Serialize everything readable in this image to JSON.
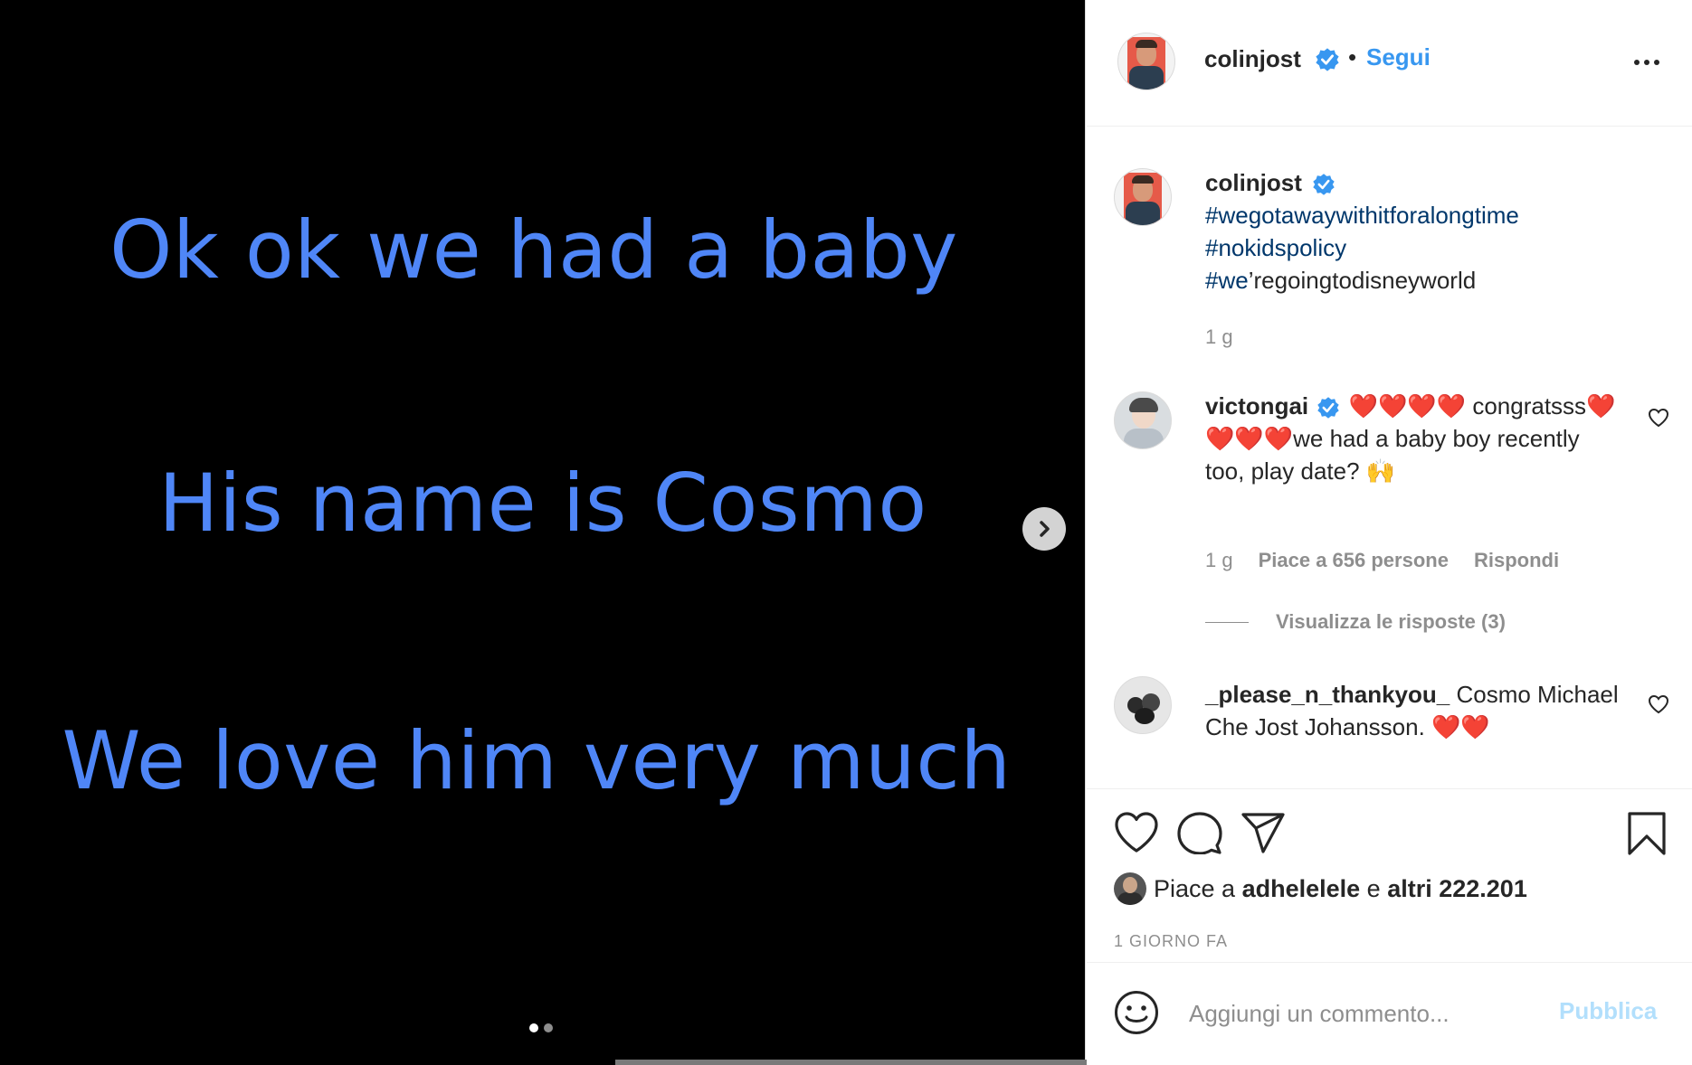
{
  "media": {
    "lines": [
      "Ok ok we had a baby",
      "His name is Cosmo",
      "We love him very much"
    ],
    "text_color": "#4f86f7",
    "carousel": {
      "current": 1,
      "total": 2
    }
  },
  "header": {
    "username": "colinjost",
    "separator": "•",
    "follow_label": "Segui"
  },
  "caption": {
    "username": "colinjost",
    "hashtags": [
      "#wegotawaywithitforalongtime",
      "#nokidspolicy",
      "#we"
    ],
    "hashtag_suffix": "’regoingtodisneyworld",
    "time": "1 g"
  },
  "comments": [
    {
      "username": "victongai",
      "verified": true,
      "text": "❤️❤️❤️❤️ congratsss❤️❤️❤️❤️we had a baby boy recently too, play date? 🙌",
      "time": "1 g",
      "likes": "Piace a 656 persone",
      "reply_label": "Rispondi",
      "view_replies": "Visualizza le risposte (3)"
    },
    {
      "username": "_please_n_thankyou_",
      "verified": false,
      "text": "Cosmo Michael Che Jost Johansson. ❤️❤️"
    }
  ],
  "actions": {
    "likes_prefix": "Piace a",
    "likes_user": "adhelelele",
    "likes_middle": "e",
    "likes_others": "altri 222.201",
    "timestamp": "1 GIORNO FA"
  },
  "add_comment": {
    "placeholder": "Aggiungi un commento...",
    "publish_label": "Pubblica"
  },
  "colors": {
    "accent": "#3897f0",
    "hashtag": "#00376b",
    "verified": "#3897f0",
    "publish_disabled": "#b2dffc",
    "muted": "#8e8e8e"
  }
}
